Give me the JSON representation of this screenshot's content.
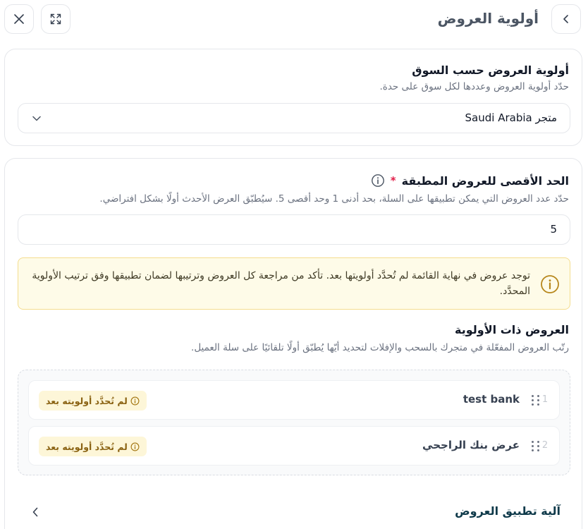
{
  "header": {
    "title": "أولوية العروض",
    "back_icon": "chevron-left-icon",
    "expand_icon": "expand-icon",
    "close_icon": "close-icon"
  },
  "market_section": {
    "title": "أولوية العروض حسب السوق",
    "subtitle": "حدّد أولوية العروض وعددها لكل سوق على حدة.",
    "selected_store": "متجر Saudi Arabia"
  },
  "max_offers": {
    "title": "الحد الأقصى للعروض المطبقة",
    "required_mark": "*",
    "subtitle": "حدّد عدد العروض التي يمكن تطبيقها على السلة، بحد أدنى 1 وحد أقصى 5. سيُطبّق العرض الأحدث أولًا بشكل افتراضي.",
    "value": "5"
  },
  "warning": {
    "text": "توجد عروض في نهاية القائمة لم تُحدَّد أولويتها بعد. تأكد من مراجعة كل العروض وترتيبها لضمان تطبيقها وفق ترتيب الأولوية المحدَّد."
  },
  "priority": {
    "title": "العروض ذات الأولوية",
    "subtitle": "رتّب العروض المفعّلة في متجرك بالسحب والإفلات لتحديد أيّها يُطبّق أولًا تلقائيًا على سلة العميل.",
    "items": [
      {
        "index": "1",
        "name": "test bank",
        "badge": "لم تُحدَّد أولويته بعد"
      },
      {
        "index": "2",
        "name": "عرض بنك الراجحي",
        "badge": "لم تُحدَّد أولويته بعد"
      }
    ]
  },
  "footer": {
    "link": "آلية تطبيق العروض"
  },
  "colors": {
    "warning_bg": "#fefbe8",
    "warning_border": "#f4dd8e",
    "warning_icon": "#b7871c",
    "required": "#e11d48",
    "link": "#0f3a4a"
  }
}
